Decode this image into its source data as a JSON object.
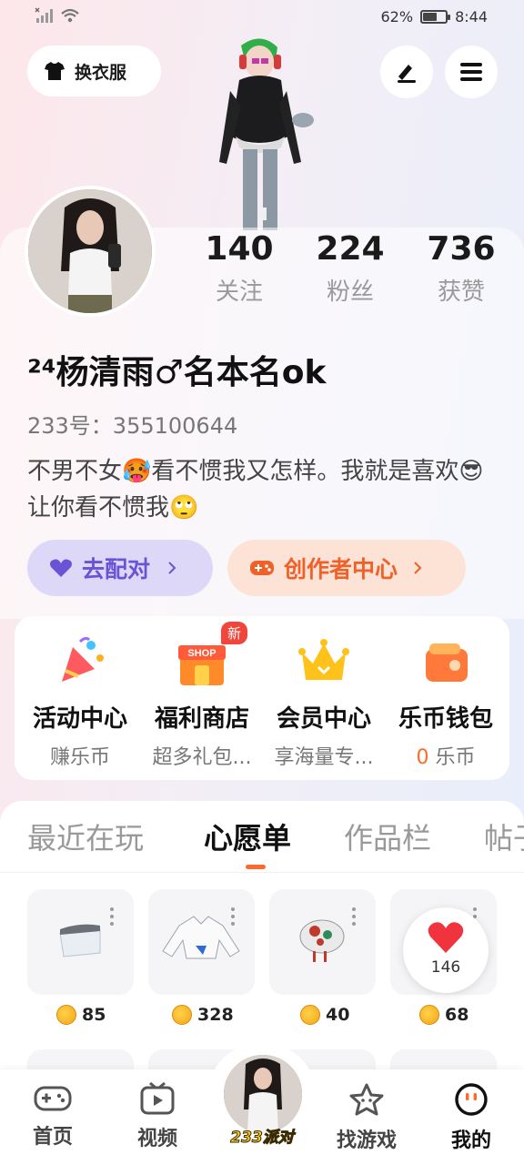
{
  "status_bar": {
    "battery": "62%",
    "battery_level": 0.62,
    "time": "8:44"
  },
  "header": {
    "outfit_button": "换衣服"
  },
  "stats": [
    {
      "value": "140",
      "label": "关注"
    },
    {
      "value": "224",
      "label": "粉丝"
    },
    {
      "value": "736",
      "label": "获赞"
    }
  ],
  "profile": {
    "username": "²⁴杨清雨♂名本名ok",
    "user_id": "233号：355100644",
    "bio": "不男不女🥵看不惯我又怎样。我就是喜欢😎让你看不惯我🙄"
  },
  "actions": {
    "match": "去配对",
    "creator_center": "创作者中心"
  },
  "menu": [
    {
      "title": "活动中心",
      "subtitle": "赚乐币",
      "icon": "party-popper-icon"
    },
    {
      "title": "福利商店",
      "subtitle": "超多礼包...",
      "icon": "shop-icon",
      "badge": "新",
      "badge_icon_text": "SHOP"
    },
    {
      "title": "会员中心",
      "subtitle": "享海量专...",
      "icon": "crown-icon"
    },
    {
      "title": "乐币钱包",
      "subtitle_value": "0",
      "subtitle": "乐币",
      "icon": "wallet-icon"
    }
  ],
  "tabs": [
    {
      "label": "最近在玩",
      "active": false
    },
    {
      "label": "心愿单",
      "active": true
    },
    {
      "label": "作品栏",
      "active": false
    },
    {
      "label": "帖子",
      "active": false
    }
  ],
  "wishlist": [
    {
      "price": "85",
      "item": "visor"
    },
    {
      "price": "328",
      "item": "shirt"
    },
    {
      "price": "40",
      "item": "beret"
    },
    {
      "price": "68",
      "item": "hidden"
    }
  ],
  "like_bubble": {
    "count": "146"
  },
  "bottom_nav": [
    {
      "label": "首页",
      "icon": "gamepad-icon"
    },
    {
      "label": "视频",
      "icon": "video-icon"
    },
    {
      "label": "233派对",
      "icon": "party-avatar"
    },
    {
      "label": "找游戏",
      "icon": "star-icon"
    },
    {
      "label": "我的",
      "icon": "me-icon"
    }
  ],
  "colors": {
    "accent": "#ff6a2a",
    "match_purple": "#6b53d6",
    "creator_orange": "#f0612a"
  }
}
